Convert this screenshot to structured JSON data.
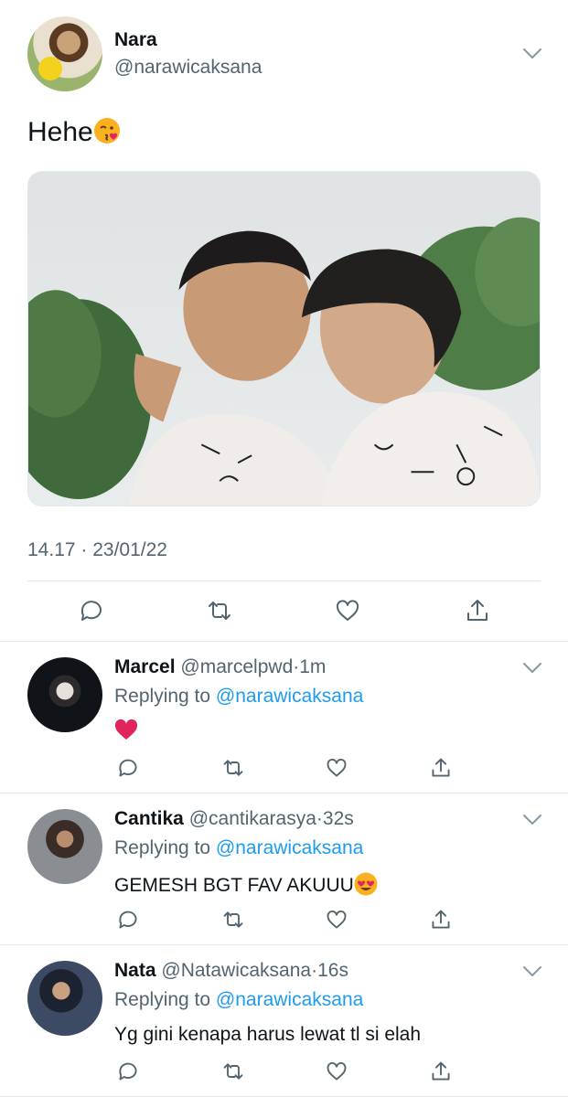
{
  "main_tweet": {
    "name": "Nara",
    "handle": "@narawicaksana",
    "text": "Hehe",
    "text_emoji": "kissing-face-emoji",
    "timestamp": "14.17 · 23/01/22",
    "actions": [
      "reply-icon",
      "retweet-icon",
      "like-icon",
      "share-icon"
    ]
  },
  "replies": [
    {
      "name": "Marcel",
      "handle": "@marcelpwd",
      "separator": "·",
      "time": "1m",
      "replying_label": "Replying to",
      "replying_to": "@narawicaksana",
      "text": "",
      "text_emoji": "red-heart-emoji"
    },
    {
      "name": "Cantika",
      "handle": "@cantikarasya",
      "separator": "·",
      "time": "32s",
      "replying_label": "Replying to",
      "replying_to": "@narawicaksana",
      "text": "GEMESH BGT FAV AKUUU",
      "text_emoji": "heart-eyes-emoji"
    },
    {
      "name": "Nata",
      "handle": "@Natawicaksana",
      "separator": "·",
      "time": "16s",
      "replying_label": "Replying to",
      "replying_to": "@narawicaksana",
      "text": "Yg gini kenapa harus lewat tl si elah",
      "text_emoji": ""
    }
  ],
  "colors": {
    "text": "#0f1419",
    "secondary": "#536471",
    "link": "#1d9bf0",
    "divider": "#e1e8ed"
  }
}
